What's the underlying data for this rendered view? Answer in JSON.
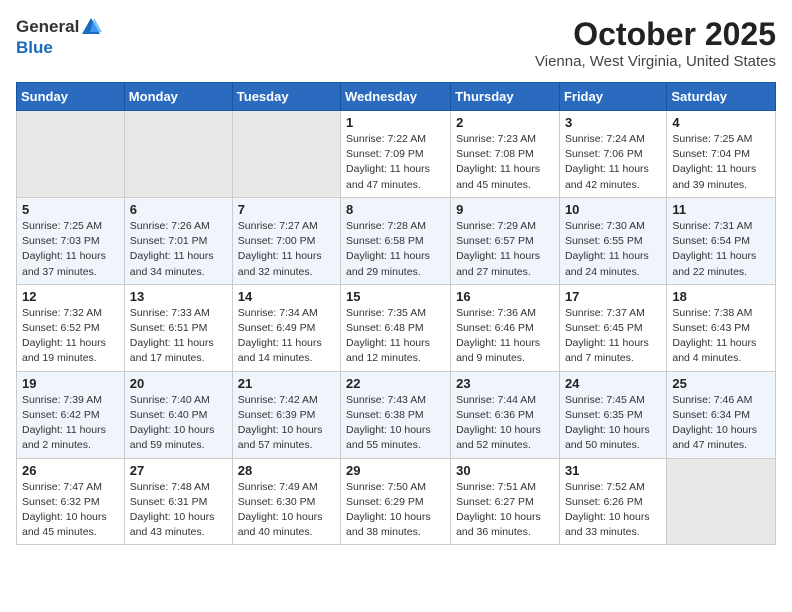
{
  "header": {
    "logo_general": "General",
    "logo_blue": "Blue",
    "month": "October 2025",
    "location": "Vienna, West Virginia, United States"
  },
  "days_of_week": [
    "Sunday",
    "Monday",
    "Tuesday",
    "Wednesday",
    "Thursday",
    "Friday",
    "Saturday"
  ],
  "weeks": [
    [
      {
        "day": "",
        "info": ""
      },
      {
        "day": "",
        "info": ""
      },
      {
        "day": "",
        "info": ""
      },
      {
        "day": "1",
        "info": "Sunrise: 7:22 AM\nSunset: 7:09 PM\nDaylight: 11 hours and 47 minutes."
      },
      {
        "day": "2",
        "info": "Sunrise: 7:23 AM\nSunset: 7:08 PM\nDaylight: 11 hours and 45 minutes."
      },
      {
        "day": "3",
        "info": "Sunrise: 7:24 AM\nSunset: 7:06 PM\nDaylight: 11 hours and 42 minutes."
      },
      {
        "day": "4",
        "info": "Sunrise: 7:25 AM\nSunset: 7:04 PM\nDaylight: 11 hours and 39 minutes."
      }
    ],
    [
      {
        "day": "5",
        "info": "Sunrise: 7:25 AM\nSunset: 7:03 PM\nDaylight: 11 hours and 37 minutes."
      },
      {
        "day": "6",
        "info": "Sunrise: 7:26 AM\nSunset: 7:01 PM\nDaylight: 11 hours and 34 minutes."
      },
      {
        "day": "7",
        "info": "Sunrise: 7:27 AM\nSunset: 7:00 PM\nDaylight: 11 hours and 32 minutes."
      },
      {
        "day": "8",
        "info": "Sunrise: 7:28 AM\nSunset: 6:58 PM\nDaylight: 11 hours and 29 minutes."
      },
      {
        "day": "9",
        "info": "Sunrise: 7:29 AM\nSunset: 6:57 PM\nDaylight: 11 hours and 27 minutes."
      },
      {
        "day": "10",
        "info": "Sunrise: 7:30 AM\nSunset: 6:55 PM\nDaylight: 11 hours and 24 minutes."
      },
      {
        "day": "11",
        "info": "Sunrise: 7:31 AM\nSunset: 6:54 PM\nDaylight: 11 hours and 22 minutes."
      }
    ],
    [
      {
        "day": "12",
        "info": "Sunrise: 7:32 AM\nSunset: 6:52 PM\nDaylight: 11 hours and 19 minutes."
      },
      {
        "day": "13",
        "info": "Sunrise: 7:33 AM\nSunset: 6:51 PM\nDaylight: 11 hours and 17 minutes."
      },
      {
        "day": "14",
        "info": "Sunrise: 7:34 AM\nSunset: 6:49 PM\nDaylight: 11 hours and 14 minutes."
      },
      {
        "day": "15",
        "info": "Sunrise: 7:35 AM\nSunset: 6:48 PM\nDaylight: 11 hours and 12 minutes."
      },
      {
        "day": "16",
        "info": "Sunrise: 7:36 AM\nSunset: 6:46 PM\nDaylight: 11 hours and 9 minutes."
      },
      {
        "day": "17",
        "info": "Sunrise: 7:37 AM\nSunset: 6:45 PM\nDaylight: 11 hours and 7 minutes."
      },
      {
        "day": "18",
        "info": "Sunrise: 7:38 AM\nSunset: 6:43 PM\nDaylight: 11 hours and 4 minutes."
      }
    ],
    [
      {
        "day": "19",
        "info": "Sunrise: 7:39 AM\nSunset: 6:42 PM\nDaylight: 11 hours and 2 minutes."
      },
      {
        "day": "20",
        "info": "Sunrise: 7:40 AM\nSunset: 6:40 PM\nDaylight: 10 hours and 59 minutes."
      },
      {
        "day": "21",
        "info": "Sunrise: 7:42 AM\nSunset: 6:39 PM\nDaylight: 10 hours and 57 minutes."
      },
      {
        "day": "22",
        "info": "Sunrise: 7:43 AM\nSunset: 6:38 PM\nDaylight: 10 hours and 55 minutes."
      },
      {
        "day": "23",
        "info": "Sunrise: 7:44 AM\nSunset: 6:36 PM\nDaylight: 10 hours and 52 minutes."
      },
      {
        "day": "24",
        "info": "Sunrise: 7:45 AM\nSunset: 6:35 PM\nDaylight: 10 hours and 50 minutes."
      },
      {
        "day": "25",
        "info": "Sunrise: 7:46 AM\nSunset: 6:34 PM\nDaylight: 10 hours and 47 minutes."
      }
    ],
    [
      {
        "day": "26",
        "info": "Sunrise: 7:47 AM\nSunset: 6:32 PM\nDaylight: 10 hours and 45 minutes."
      },
      {
        "day": "27",
        "info": "Sunrise: 7:48 AM\nSunset: 6:31 PM\nDaylight: 10 hours and 43 minutes."
      },
      {
        "day": "28",
        "info": "Sunrise: 7:49 AM\nSunset: 6:30 PM\nDaylight: 10 hours and 40 minutes."
      },
      {
        "day": "29",
        "info": "Sunrise: 7:50 AM\nSunset: 6:29 PM\nDaylight: 10 hours and 38 minutes."
      },
      {
        "day": "30",
        "info": "Sunrise: 7:51 AM\nSunset: 6:27 PM\nDaylight: 10 hours and 36 minutes."
      },
      {
        "day": "31",
        "info": "Sunrise: 7:52 AM\nSunset: 6:26 PM\nDaylight: 10 hours and 33 minutes."
      },
      {
        "day": "",
        "info": ""
      }
    ]
  ]
}
